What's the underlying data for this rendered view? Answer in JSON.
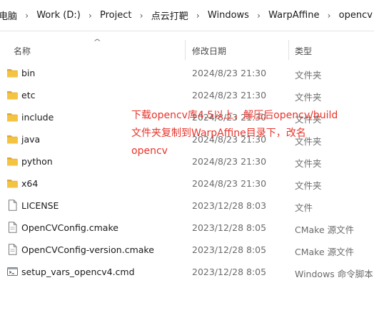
{
  "breadcrumb": {
    "items": [
      "电脑",
      "Work (D:)",
      "Project",
      "点云打靶",
      "Windows",
      "WarpAffine",
      "opencv"
    ]
  },
  "columns": {
    "name": "名称",
    "date": "修改日期",
    "type": "类型"
  },
  "files": [
    {
      "name": "bin",
      "date": "2024/8/23 21:30",
      "type": "文件夹",
      "icon": "folder-icon"
    },
    {
      "name": "etc",
      "date": "2024/8/23 21:30",
      "type": "文件夹",
      "icon": "folder-icon"
    },
    {
      "name": "include",
      "date": "2024/8/23 21:30",
      "type": "文件夹",
      "icon": "folder-icon"
    },
    {
      "name": "java",
      "date": "2024/8/23 21:30",
      "type": "文件夹",
      "icon": "folder-icon"
    },
    {
      "name": "python",
      "date": "2024/8/23 21:30",
      "type": "文件夹",
      "icon": "folder-icon"
    },
    {
      "name": "x64",
      "date": "2024/8/23 21:30",
      "type": "文件夹",
      "icon": "folder-icon"
    },
    {
      "name": "LICENSE",
      "date": "2023/12/28 8:03",
      "type": "文件",
      "icon": "file-icon"
    },
    {
      "name": "OpenCVConfig.cmake",
      "date": "2023/12/28 8:05",
      "type": "CMake 源文件",
      "icon": "cmake-file-icon"
    },
    {
      "name": "OpenCVConfig-version.cmake",
      "date": "2023/12/28 8:05",
      "type": "CMake 源文件",
      "icon": "cmake-file-icon"
    },
    {
      "name": "setup_vars_opencv4.cmd",
      "date": "2023/12/28 8:05",
      "type": "Windows 命令脚本",
      "icon": "cmd-script-icon"
    }
  ],
  "annotation": {
    "lines": [
      "下载opencv库4.5以上，解压后opencv/build",
      "文件夹复制到WarpAffine目录下，改名",
      "opencv"
    ]
  },
  "colors": {
    "folder": "#f5c342",
    "annotation": "#e8332a"
  }
}
